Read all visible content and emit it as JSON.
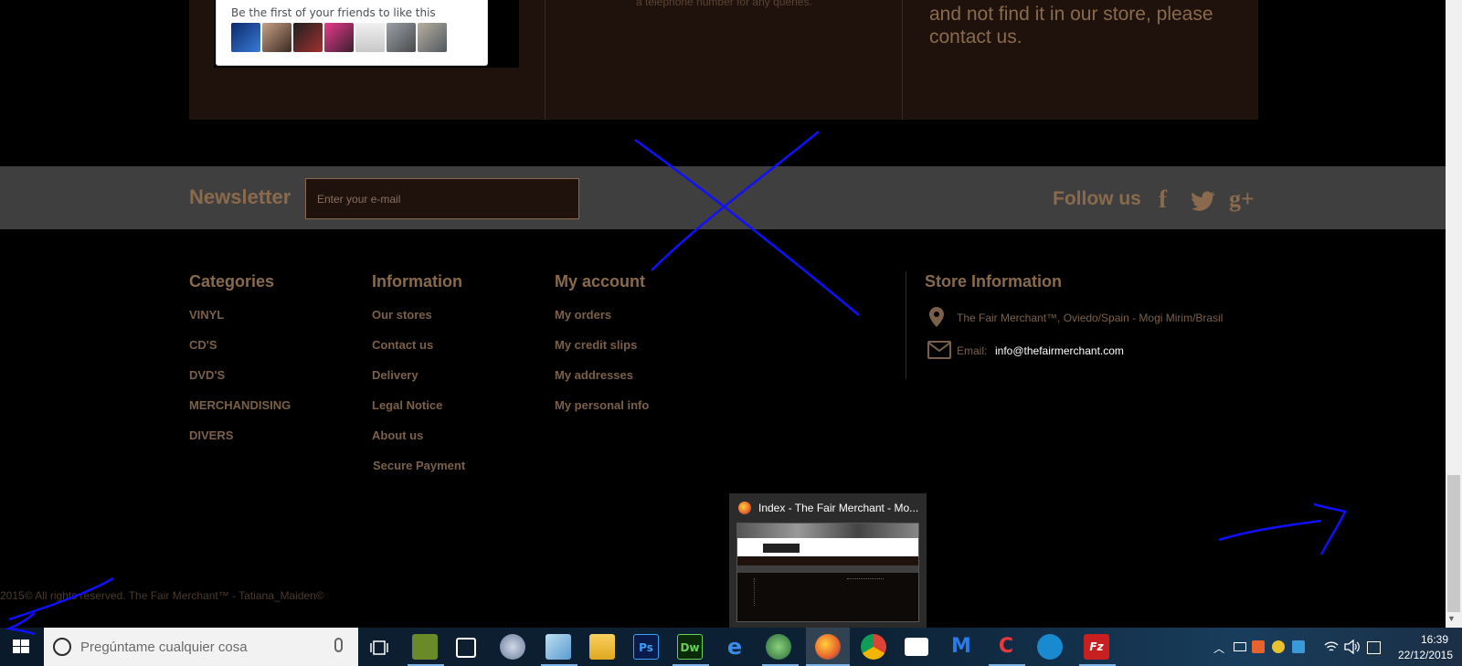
{
  "top": {
    "facebook_text": "Be the first of your friends to like this",
    "phone_text": "a telephone number for any queries.",
    "contact_text": "and not find it in our store, please contact us."
  },
  "newsletter": {
    "title": "Newsletter",
    "placeholder": "Enter your e-mail"
  },
  "follow": {
    "title": "Follow us",
    "icons": [
      "facebook-icon",
      "twitter-icon",
      "google-plus-icon"
    ],
    "facebook_glyph": "f",
    "google_glyph": "g+"
  },
  "categories": {
    "title": "Categories",
    "items": [
      "VINYL",
      "CD'S",
      "DVD'S",
      "MERCHANDISING",
      "DIVERS"
    ]
  },
  "information": {
    "title": "Information",
    "items": [
      "Our stores",
      "Contact us",
      "Delivery",
      "Legal Notice",
      "About us",
      "Secure Payment"
    ]
  },
  "account": {
    "title": "My account",
    "items": [
      "My orders",
      "My credit slips",
      "My addresses",
      "My personal info"
    ]
  },
  "store": {
    "title": "Store Information",
    "address": "The Fair Merchant™, Oviedo/Spain - Mogi Mirim/Brasil",
    "email_label": "Email:",
    "email": "info@thefairmerchant.com"
  },
  "copyright": "2015© All rights reserved. The Fair Merchant™ - Tatiana_Maiden©",
  "preview": {
    "title": "Index - The Fair Merchant - Mo..."
  },
  "taskbar": {
    "search_placeholder": "Pregúntame cualquier cosa",
    "ps_label": "Ps",
    "dw_label": "Dw",
    "fz_label": "Fz",
    "time": "16:39",
    "date": "22/12/2015"
  },
  "colors": {
    "accent": "#8a6a4c",
    "background": "#000000",
    "panel": "#1f120c",
    "newsletter_band": "#3f3f3f",
    "annotation_ink": "#1010ff"
  }
}
